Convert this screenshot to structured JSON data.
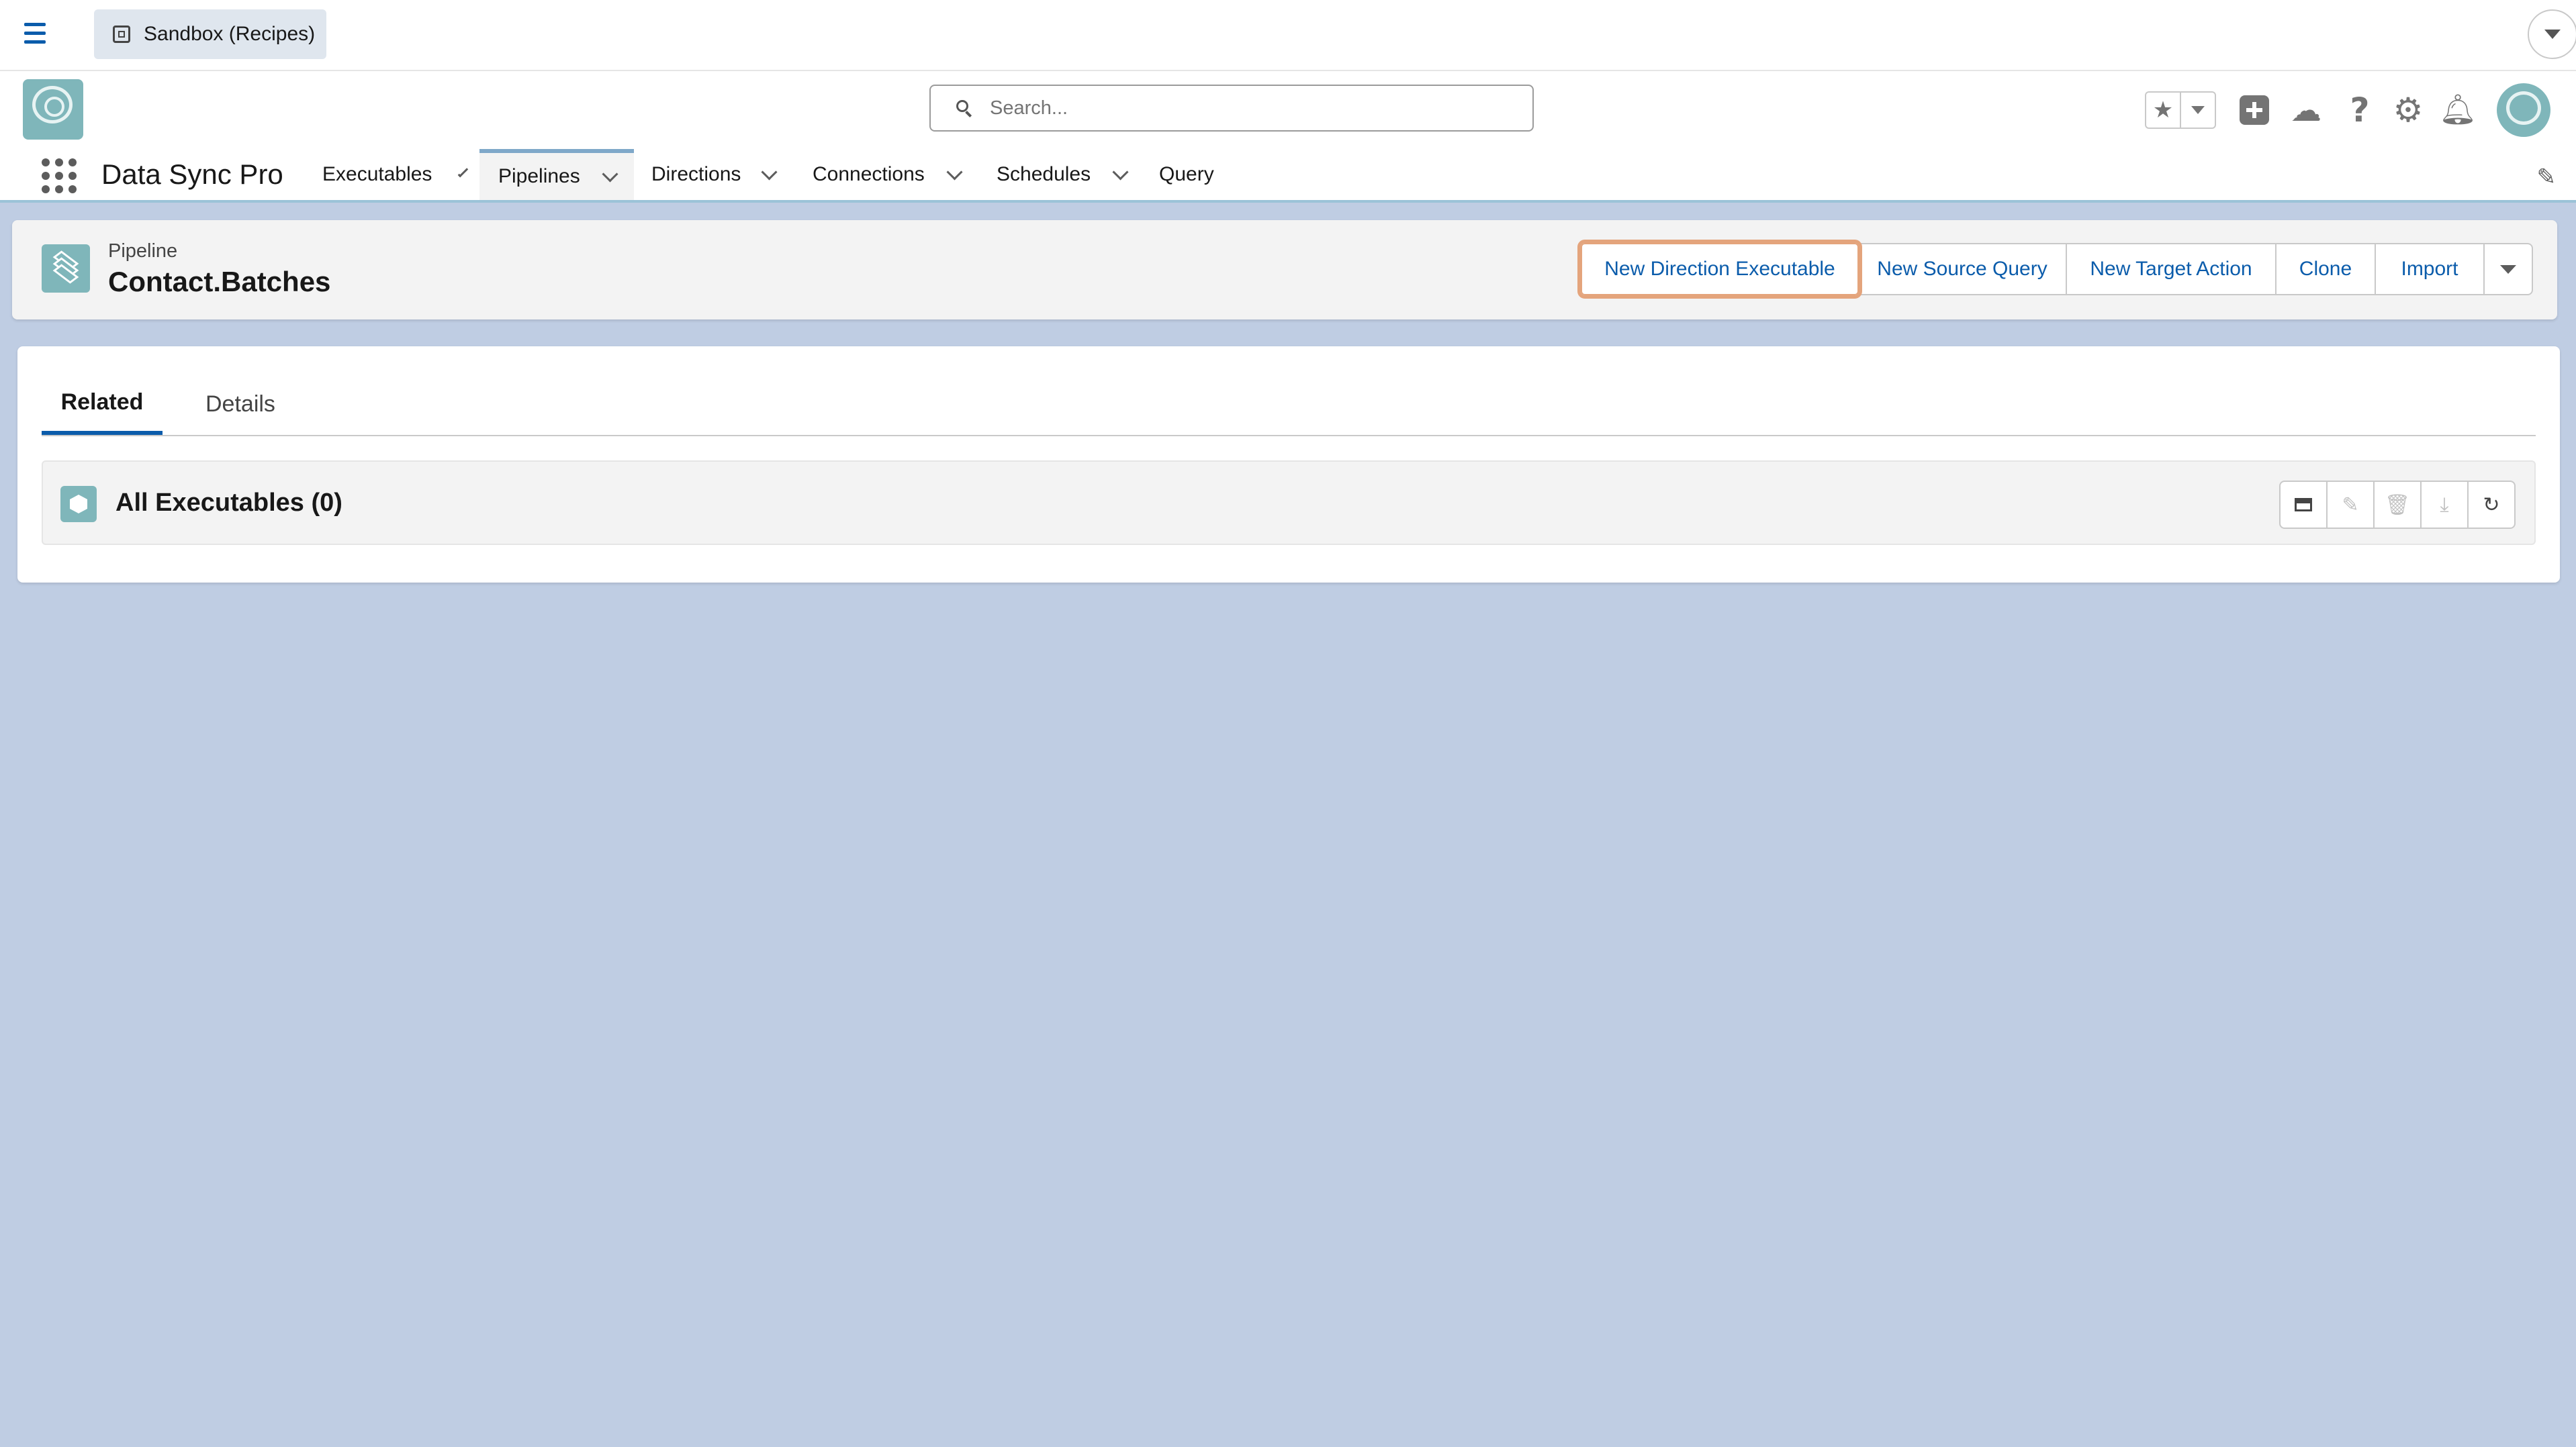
{
  "sandbox": {
    "label": "Sandbox (Recipes)"
  },
  "header": {
    "logo_text": "Data Sync Pro",
    "search_placeholder": "Search...",
    "icons": [
      "star-icon",
      "chevron-down-icon",
      "plus-icon",
      "trailhead-icon",
      "help-icon",
      "gear-icon",
      "bell-icon",
      "avatar"
    ]
  },
  "nav": {
    "app_name": "Data Sync Pro",
    "items": [
      {
        "label": "Executables",
        "has_menu": true
      },
      {
        "label": "Pipelines",
        "has_menu": true,
        "active": true
      },
      {
        "label": "Directions",
        "has_menu": true
      },
      {
        "label": "Connections",
        "has_menu": true
      },
      {
        "label": "Schedules",
        "has_menu": true
      },
      {
        "label": "Query",
        "has_menu": false
      }
    ]
  },
  "record": {
    "type_label": "Pipeline",
    "title": "Contact.Batches",
    "actions": [
      "New Direction Executable",
      "New Source Query",
      "New Target Action",
      "Clone",
      "Import"
    ]
  },
  "tabs": [
    {
      "label": "Related",
      "active": true
    },
    {
      "label": "Details",
      "active": false
    }
  ],
  "related_list": {
    "title": "All Executables (0)",
    "actions": [
      "card-view-icon",
      "edit-icon",
      "delete-icon",
      "download-icon",
      "refresh-icon"
    ]
  },
  "colors": {
    "page_background": "#bfcde3",
    "brand_blue": "#0b5cab",
    "teal_icon": "#7fb6ba",
    "focus_outline": "#e4a47c"
  }
}
